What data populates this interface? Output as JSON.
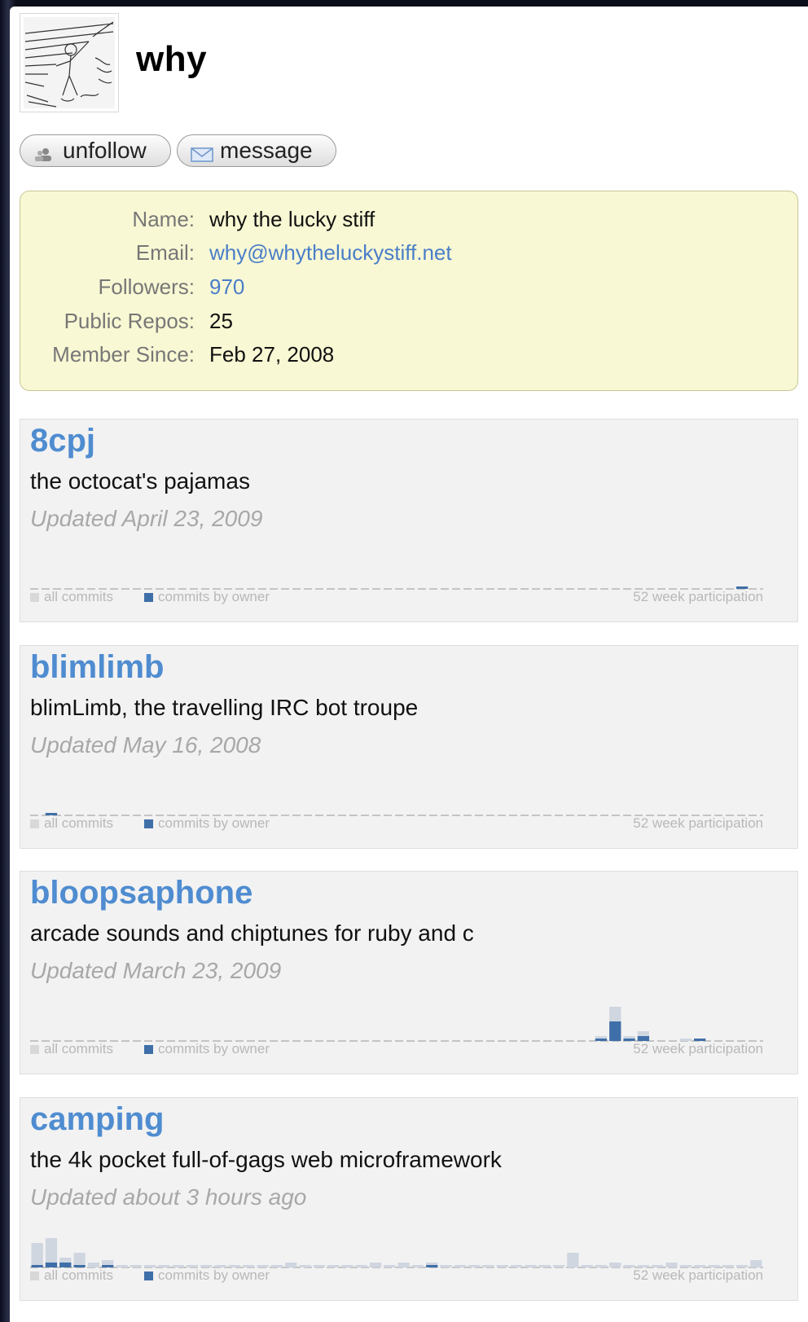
{
  "profile": {
    "username": "why",
    "avatar_icon": "sketch-avatar-icon"
  },
  "actions": {
    "unfollow_label": "unfollow",
    "message_label": "message"
  },
  "info": {
    "name_label": "Name:",
    "name_value": "why the lucky stiff",
    "email_label": "Email:",
    "email_value": "why@whytheluckystiff.net",
    "followers_label": "Followers:",
    "followers_value": "970",
    "repos_label": "Public Repos:",
    "repos_value": "25",
    "since_label": "Member Since:",
    "since_value": "Feb 27, 2008"
  },
  "legend": {
    "all": "all commits",
    "owner": "commits by owner",
    "participation": "52 week participation"
  },
  "colors": {
    "link": "#4f8cd0",
    "owner_bar": "#3f6fa8",
    "all_bar": "#cfd6e0"
  },
  "repos": [
    {
      "name": "8cpj",
      "description": "the octocat's pajamas",
      "updated": "Updated April 23, 2009",
      "all": [
        0,
        0,
        0,
        0,
        0,
        0,
        0,
        0,
        0,
        0,
        0,
        0,
        0,
        0,
        0,
        0,
        0,
        0,
        0,
        0,
        0,
        0,
        0,
        0,
        0,
        0,
        0,
        0,
        0,
        0,
        0,
        0,
        0,
        0,
        0,
        0,
        0,
        0,
        0,
        0,
        0,
        0,
        0,
        0,
        0,
        0,
        0,
        0,
        0,
        0,
        1,
        0
      ],
      "owner": [
        0,
        0,
        0,
        0,
        0,
        0,
        0,
        0,
        0,
        0,
        0,
        0,
        0,
        0,
        0,
        0,
        0,
        0,
        0,
        0,
        0,
        0,
        0,
        0,
        0,
        0,
        0,
        0,
        0,
        0,
        0,
        0,
        0,
        0,
        0,
        0,
        0,
        0,
        0,
        0,
        0,
        0,
        0,
        0,
        0,
        0,
        0,
        0,
        0,
        0,
        1,
        0
      ]
    },
    {
      "name": "blimlimb",
      "description": "blimLimb, the travelling IRC bot troupe",
      "updated": "Updated May 16, 2008",
      "all": [
        0,
        1,
        0,
        0,
        0,
        0,
        0,
        0,
        0,
        0,
        0,
        0,
        0,
        0,
        0,
        0,
        0,
        0,
        0,
        0,
        0,
        0,
        0,
        0,
        0,
        0,
        0,
        0,
        0,
        0,
        0,
        0,
        0,
        0,
        0,
        0,
        0,
        0,
        0,
        0,
        0,
        0,
        0,
        0,
        0,
        0,
        0,
        0,
        0,
        0,
        0,
        0
      ],
      "owner": [
        0,
        1,
        0,
        0,
        0,
        0,
        0,
        0,
        0,
        0,
        0,
        0,
        0,
        0,
        0,
        0,
        0,
        0,
        0,
        0,
        0,
        0,
        0,
        0,
        0,
        0,
        0,
        0,
        0,
        0,
        0,
        0,
        0,
        0,
        0,
        0,
        0,
        0,
        0,
        0,
        0,
        0,
        0,
        0,
        0,
        0,
        0,
        0,
        0,
        0,
        0,
        0
      ]
    },
    {
      "name": "bloopsaphone",
      "description": "arcade sounds and chiptunes for ruby and c",
      "updated": "Updated March 23, 2009",
      "all": [
        0,
        0,
        0,
        0,
        0,
        0,
        0,
        0,
        0,
        0,
        0,
        0,
        0,
        0,
        0,
        0,
        0,
        0,
        0,
        0,
        0,
        0,
        0,
        0,
        0,
        0,
        0,
        0,
        0,
        0,
        0,
        0,
        0,
        0,
        0,
        0,
        0,
        0,
        0,
        0,
        2,
        14,
        2,
        4,
        0,
        0,
        1,
        1,
        0,
        0,
        0,
        0
      ],
      "owner": [
        0,
        0,
        0,
        0,
        0,
        0,
        0,
        0,
        0,
        0,
        0,
        0,
        0,
        0,
        0,
        0,
        0,
        0,
        0,
        0,
        0,
        0,
        0,
        0,
        0,
        0,
        0,
        0,
        0,
        0,
        0,
        0,
        0,
        0,
        0,
        0,
        0,
        0,
        0,
        0,
        1,
        8,
        1,
        2,
        0,
        0,
        0,
        1,
        0,
        0,
        0,
        0
      ]
    },
    {
      "name": "camping",
      "description": "the 4k pocket full-of-gags web microframework",
      "updated": "Updated about 3 hours ago",
      "all": [
        10,
        12,
        4,
        6,
        2,
        3,
        1,
        1,
        1,
        1,
        1,
        1,
        1,
        1,
        1,
        1,
        1,
        1,
        2,
        1,
        1,
        1,
        1,
        1,
        2,
        1,
        2,
        1,
        2,
        1,
        1,
        1,
        1,
        1,
        1,
        1,
        1,
        1,
        6,
        1,
        1,
        2,
        1,
        1,
        1,
        2,
        1,
        1,
        1,
        1,
        1,
        3
      ],
      "owner": [
        1,
        2,
        2,
        1,
        0,
        1,
        0,
        0,
        0,
        0,
        0,
        0,
        0,
        0,
        0,
        0,
        0,
        0,
        0,
        0,
        0,
        0,
        0,
        0,
        0,
        0,
        0,
        0,
        1,
        0,
        0,
        0,
        0,
        0,
        0,
        0,
        0,
        0,
        0,
        0,
        0,
        0,
        0,
        0,
        0,
        0,
        0,
        0,
        0,
        0,
        0,
        0
      ]
    }
  ]
}
